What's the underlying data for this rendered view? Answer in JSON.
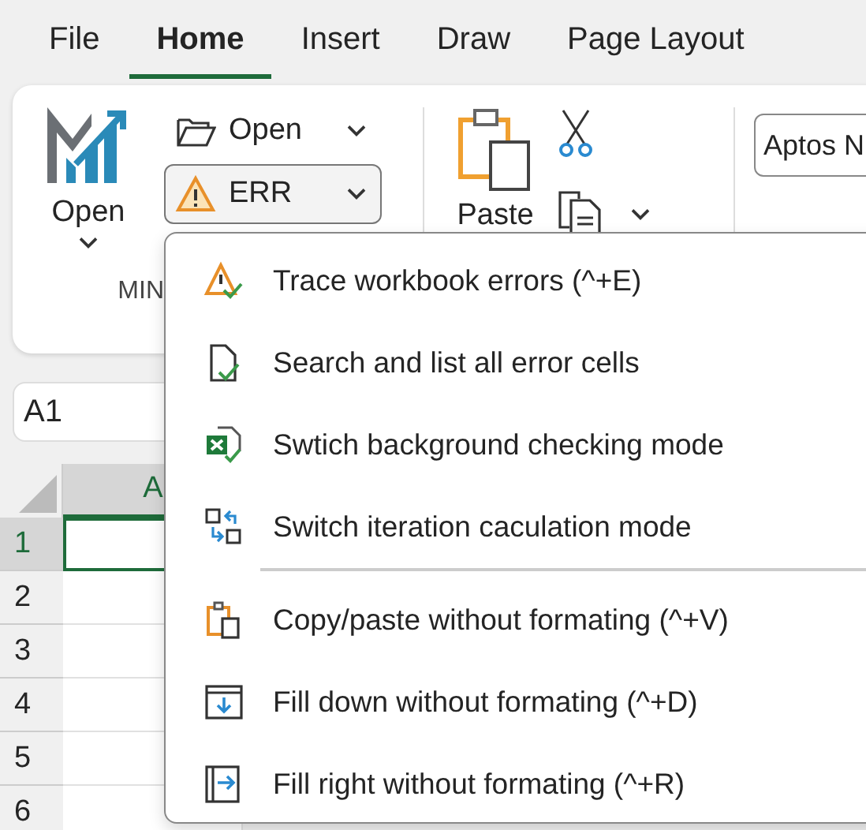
{
  "menu_tabs": [
    {
      "label": "File",
      "selected": false
    },
    {
      "label": "Home",
      "selected": true
    },
    {
      "label": "Insert",
      "selected": false
    },
    {
      "label": "Draw",
      "selected": false
    },
    {
      "label": "Page Layout",
      "selected": false
    }
  ],
  "ribbon": {
    "app_button": {
      "label": "Open"
    },
    "open_button": {
      "label": "Open"
    },
    "err_button": {
      "label": "ERR",
      "pressed": true
    },
    "group_label": "MIN",
    "paste_button": {
      "label": "Paste"
    },
    "font_box": {
      "value": "Aptos N"
    }
  },
  "name_box": {
    "value": "A1"
  },
  "sheet": {
    "columns": [
      "A"
    ],
    "rows": [
      {
        "label": "1",
        "selected": true
      },
      {
        "label": "2",
        "selected": false
      },
      {
        "label": "3",
        "selected": false
      },
      {
        "label": "4",
        "selected": false
      },
      {
        "label": "5",
        "selected": false
      },
      {
        "label": "6",
        "selected": false
      }
    ]
  },
  "dropdown": {
    "items": [
      {
        "kind": "trace",
        "label": "Trace workbook errors (^+E)",
        "separator_before": false
      },
      {
        "kind": "search",
        "label": "Search and list all error cells",
        "separator_before": false
      },
      {
        "kind": "background",
        "label": "Swtich background checking mode",
        "separator_before": false
      },
      {
        "kind": "iteration",
        "label": "Switch iteration caculation mode",
        "separator_before": false
      },
      {
        "kind": "paste",
        "label": "Copy/paste without formating (^+V)",
        "separator_before": true
      },
      {
        "kind": "fill_down",
        "label": "Fill down without formating (^+D)",
        "separator_before": false
      },
      {
        "kind": "fill_right",
        "label": "Fill right without formating (^+R)",
        "separator_before": false
      }
    ]
  }
}
